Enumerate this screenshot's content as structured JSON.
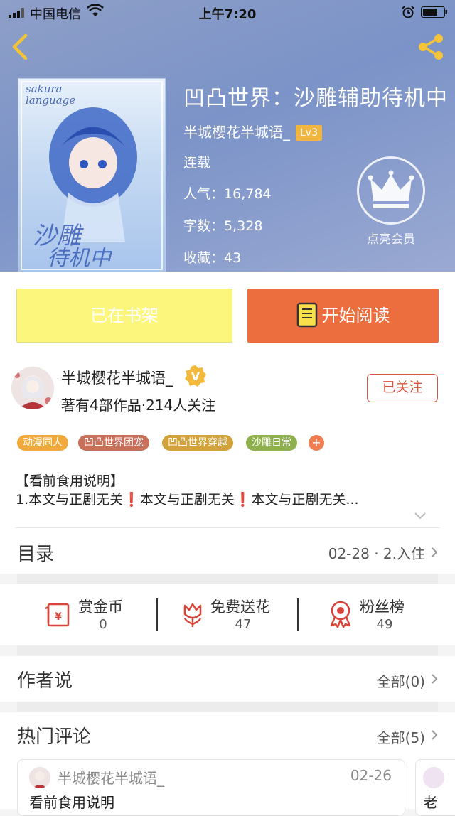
{
  "status_bar": {
    "carrier": "中国电信",
    "time": "上午7:20"
  },
  "book": {
    "title": "凹凸世界：沙雕辅助待机中",
    "author": "半城樱花半城语_",
    "level": "Lv3",
    "status": "连载",
    "popularity_label": "人气：",
    "popularity": "16,784",
    "words_label": "字数：",
    "words": "5,328",
    "favorites_label": "收藏：",
    "favorites": "43",
    "cover_text": "sakura language"
  },
  "vip": {
    "label": "点亮会员"
  },
  "actions": {
    "shelf_label": "已在书架",
    "read_label": "开始阅读"
  },
  "author_section": {
    "name": "半城樱花半城语_",
    "stats": "著有4部作品·214人关注",
    "follow_label": "已关注",
    "tags": [
      {
        "label": "动漫同人",
        "color": "#f0a93c"
      },
      {
        "label": "凹凸世界团宠",
        "color": "#c9705a"
      },
      {
        "label": "凹凸世界穿越",
        "color": "#d2a23c"
      },
      {
        "label": "沙雕日常",
        "color": "#8fb04f"
      }
    ],
    "tag_more": "+"
  },
  "description": {
    "title": "【看前食用说明】",
    "text": "1.本文与正剧无关❗本文与正剧无关❗本文与正剧无关..."
  },
  "toc": {
    "title": "目录",
    "latest": "02-28 · 2.入住"
  },
  "stats": {
    "reward_label": "赏金币",
    "reward_value": "0",
    "flowers_label": "免费送花",
    "flowers_value": "47",
    "fans_label": "粉丝榜",
    "fans_value": "49"
  },
  "author_says": {
    "title": "作者说",
    "all_label": "全部(0)"
  },
  "hot_comments": {
    "title": "热门评论",
    "all_label": "全部(5)",
    "items": [
      {
        "user": "半城樱花半城语_",
        "date": "02-26",
        "text": "看前食用说明"
      },
      {
        "user": "",
        "date": "",
        "text": "老"
      }
    ]
  },
  "colors": {
    "accent": "#ec6d3d",
    "shelf": "#fcf67c",
    "follow": "#d9533f",
    "level_badge": "#f0b640"
  }
}
